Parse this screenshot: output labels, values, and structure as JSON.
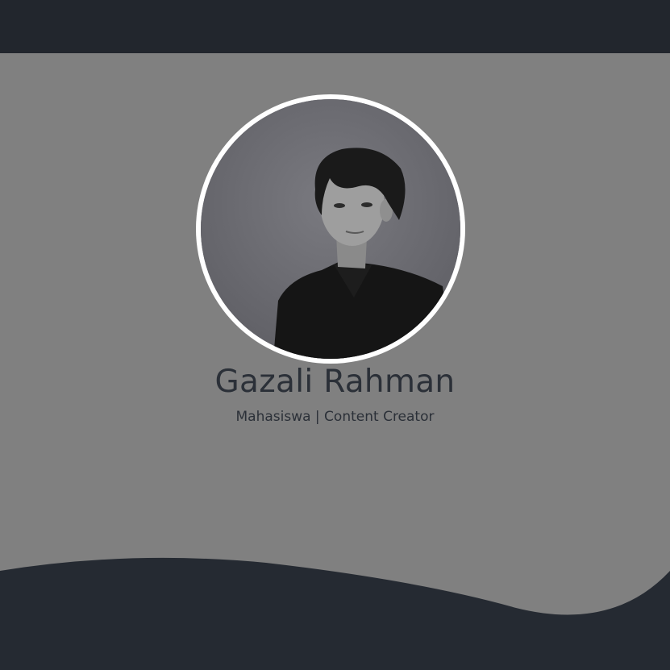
{
  "colors": {
    "background": "#808080",
    "navbar": "#22262d",
    "wave": "#252a32",
    "text": "#2b3038",
    "avatar_border": "#ffffff"
  },
  "profile": {
    "name": "Gazali Rahman",
    "subtitle": "Mahasiswa | Content Creator",
    "photo": "profile-photo-grayscale"
  }
}
